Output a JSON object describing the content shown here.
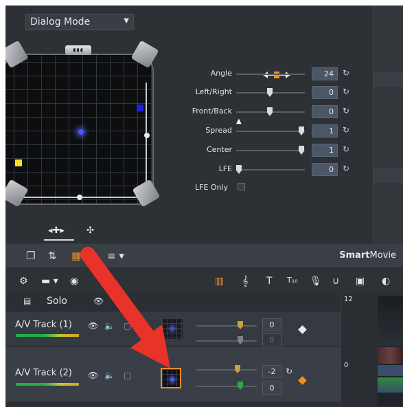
{
  "surround": {
    "mode_select": {
      "value": "Dialog Mode"
    },
    "params": [
      {
        "label": "Angle",
        "value": "24"
      },
      {
        "label": "Left/Right",
        "value": "0"
      },
      {
        "label": "Front/Back",
        "value": "0"
      },
      {
        "label": "Spread",
        "value": "1"
      },
      {
        "label": "Center",
        "value": "1"
      },
      {
        "label": "LFE",
        "value": "0"
      }
    ],
    "lfe_only_label": "LFE Only"
  },
  "toolbar": {
    "brand_bold": "Smart",
    "brand_regular": "Movie"
  },
  "tracks": {
    "solo_label": "Solo",
    "timeline_marks": [
      "12",
      "0"
    ],
    "rows": [
      {
        "name": "A/V Track (1)",
        "volume": "0",
        "pan": "0"
      },
      {
        "name": "A/V Track (2)",
        "volume": "-2",
        "pan": "0"
      }
    ]
  },
  "colors": {
    "accent_orange": "#e8902a",
    "annotation_red": "#e8322a",
    "panel_bg": "#2d3035",
    "value_box": "#4b5666"
  }
}
